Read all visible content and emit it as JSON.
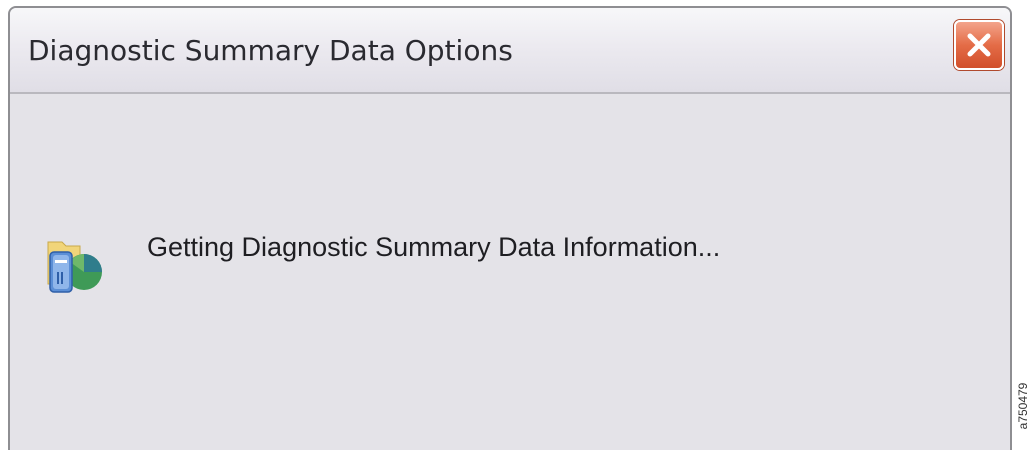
{
  "window": {
    "title": "Diagnostic Summary Data Options",
    "close_icon": "close-icon"
  },
  "content": {
    "icon": "data-folder-icon",
    "message": "Getting Diagnostic Summary Data Information..."
  },
  "figure_id": "a750479",
  "colors": {
    "dialog_background": "#e4e3e8",
    "close_button": "#e46c47",
    "border": "#8e8e92"
  }
}
